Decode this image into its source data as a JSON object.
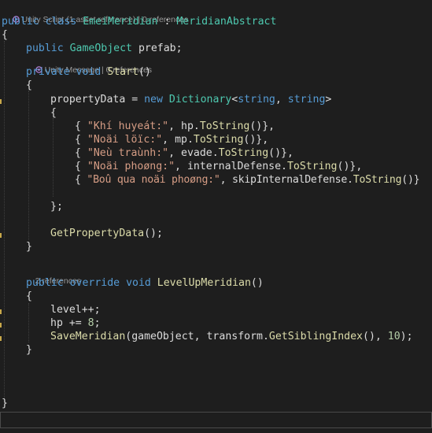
{
  "code_lens": {
    "class_refs": "Unity Script (1 asset reference) | 0 references",
    "start_refs": "Unity Message | 0 references",
    "levelup_refs": "2 references"
  },
  "code": {
    "l1": {
      "kw1": "public",
      "kw2": "class",
      "name": "EmeiMeridian",
      "colon": " : ",
      "base": "MeridianAbstract"
    },
    "l2": "{",
    "l3": {
      "kw": "public",
      "type": "GameObject",
      "rest": " prefab;"
    },
    "l4": {
      "kw1": "private",
      "kw2": "void",
      "method": "Start",
      "rest": "()"
    },
    "l5": "{",
    "l6": {
      "var": "propertyData = ",
      "kw_new": "new",
      "type": "Dictionary",
      "lt": "<",
      "kw_s1": "string",
      "comma": ", ",
      "kw_s2": "string",
      "gt": ">"
    },
    "l7": "{",
    "entries": [
      {
        "open": "{ ",
        "str": "\"Khí huyeát:\"",
        "sep": ", ",
        "obj": "hp.",
        "call": "ToString",
        "close": "()},"
      },
      {
        "open": "{ ",
        "str": "\"Noäi löïc:\"",
        "sep": ", ",
        "obj": "mp.",
        "call": "ToString",
        "close": "()},"
      },
      {
        "open": "{ ",
        "str": "\"Neù traùnh:\"",
        "sep": ", ",
        "obj": "evade.",
        "call": "ToString",
        "close": "()},"
      },
      {
        "open": "{ ",
        "str": "\"Noäi phoøng:\"",
        "sep": ", ",
        "obj": "internalDefense.",
        "call": "ToString",
        "close": "()},"
      },
      {
        "open": "{ ",
        "str": "\"Boû qua noäi phoøng:\"",
        "sep": ", ",
        "obj": "skipInternalDefense.",
        "call": "ToString",
        "close": "()}"
      }
    ],
    "l13": "};",
    "l14": {
      "method": "GetPropertyData",
      "rest": "();"
    },
    "l15": "}",
    "l16": {
      "kw1": "public",
      "kw2": "override",
      "kw3": "void",
      "method": "LevelUpMeridian",
      "rest": "()"
    },
    "l17": "{",
    "l18": "level++;",
    "l19": {
      "pre": "hp += ",
      "num": "8",
      "post": ";"
    },
    "l20": {
      "method": "SaveMeridian",
      "a": "(gameObject, transform.",
      "method2": "GetSiblingIndex",
      "b": "(), ",
      "num": "10",
      "c": ");"
    },
    "l21": "}",
    "l22": "}"
  },
  "colors": {
    "background": "#1e1e1e",
    "keyword": "#569cd6",
    "type": "#4ec9b0",
    "method": "#dcdcaa",
    "string": "#d69d85",
    "number": "#b5cea8",
    "plain": "#dcdcdc",
    "lens": "#999999"
  }
}
